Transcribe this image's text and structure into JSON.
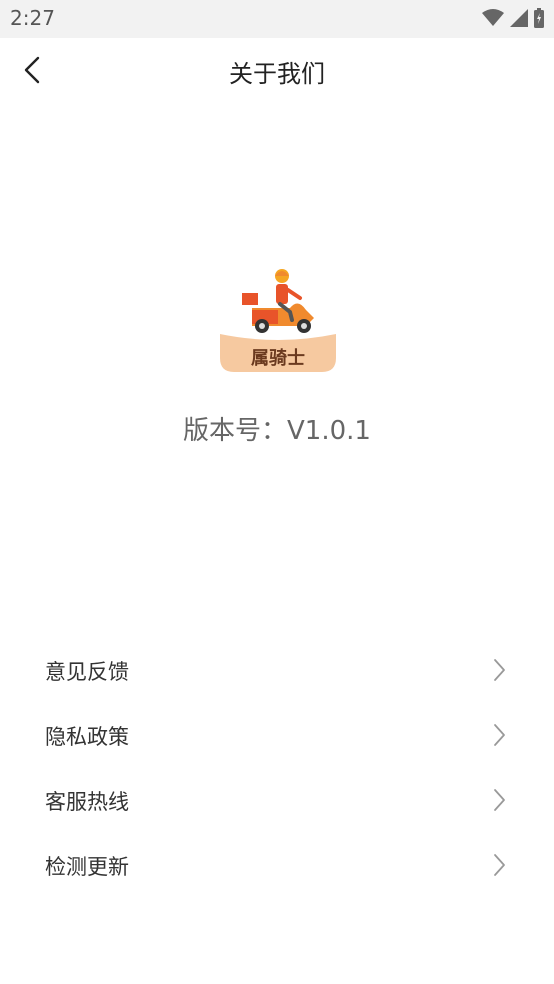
{
  "status_bar": {
    "time": "2:27",
    "icons": [
      "wifi-icon",
      "signal-icon",
      "battery-icon"
    ]
  },
  "nav": {
    "title": "关于我们",
    "back_icon": "chevron-left-icon"
  },
  "app": {
    "logo_text": "属骑士",
    "version": "版本号：V1.0.1"
  },
  "menu": {
    "items": [
      {
        "label": "意见反馈",
        "icon": "chevron-right-icon"
      },
      {
        "label": "隐私政策",
        "icon": "chevron-right-icon"
      },
      {
        "label": "客服热线",
        "icon": "chevron-right-icon"
      },
      {
        "label": "检测更新",
        "icon": "chevron-right-icon"
      }
    ]
  },
  "colors": {
    "accent": "#f08a2e",
    "logo_bg": "#f6c9a0",
    "text": "#333333",
    "chevron": "#999999"
  }
}
